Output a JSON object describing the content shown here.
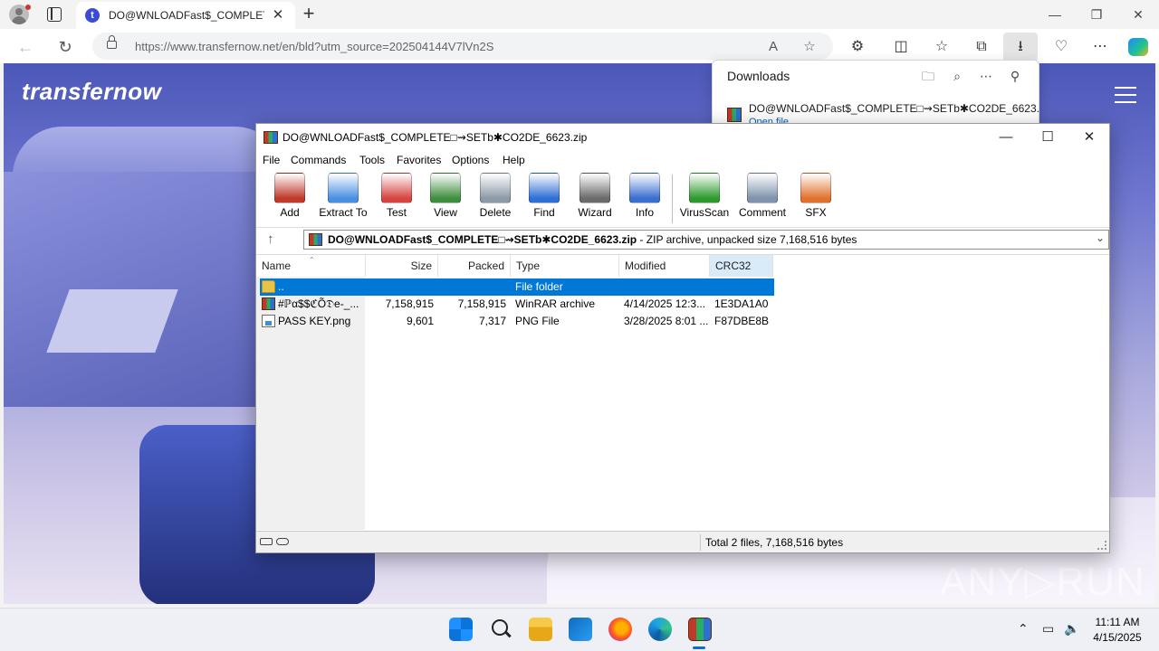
{
  "browser": {
    "tab_title": "DO@WNLOADFast$_COMPLETE□",
    "tab_favicon": "t",
    "url_host": "https://www.transfernow.net",
    "url_path": "/en/bld?utm_source=202504144V7lVn2S",
    "icons": [
      "back-icon",
      "refresh-icon",
      "lock-icon",
      "read-aloud-icon",
      "favorite-star-icon",
      "extensions-icon",
      "split-screen-icon",
      "favorites-icon",
      "collections-icon",
      "downloads-icon",
      "browser-essentials-icon",
      "more-icon",
      "copilot-icon"
    ]
  },
  "page": {
    "brand": "transfernow",
    "watermark": "ANY▷RUN"
  },
  "downloads": {
    "title": "Downloads",
    "item_name": "DO@WNLOADFast$_COMPLETE□⇝SETb✱CO2DE_6623....",
    "item_action": "Open file"
  },
  "winrar": {
    "title": "DO@WNLOADFast$_COMPLETE□⇝SETb✱CO2DE_6623.zip",
    "menu": [
      "File",
      "Commands",
      "Tools",
      "Favorites",
      "Options",
      "Help"
    ],
    "tools": [
      {
        "label": "Add",
        "color": "#c0392b"
      },
      {
        "label": "Extract To",
        "color": "#4a90e2"
      },
      {
        "label": "Test",
        "color": "#d64541"
      },
      {
        "label": "View",
        "color": "#3f8f3f"
      },
      {
        "label": "Delete",
        "color": "#8c9aa8"
      },
      {
        "label": "Find",
        "color": "#2f6fd6"
      },
      {
        "label": "Wizard",
        "color": "#6b6b6b"
      },
      {
        "label": "Info",
        "color": "#3b6fd0"
      },
      {
        "label": "VirusScan",
        "color": "#2e9b2e"
      },
      {
        "label": "Comment",
        "color": "#7f93ad"
      },
      {
        "label": "SFX",
        "color": "#e0722d"
      }
    ],
    "path_name": "DO@WNLOADFast$_COMPLETE□⇝SETb✱CO2DE_6623.zip",
    "path_desc": " - ZIP archive, unpacked size 7,168,516 bytes",
    "columns": [
      "Name",
      "Size",
      "Packed",
      "Type",
      "Modified",
      "CRC32"
    ],
    "rows": [
      {
        "name": "..",
        "size": "",
        "packed": "",
        "type": "File folder",
        "modified": "",
        "crc": ""
      },
      {
        "name": "#ℙα$$ℭÕ𝔇e-_...",
        "size": "7,158,915",
        "packed": "7,158,915",
        "type": "WinRAR archive",
        "modified": "4/14/2025 12:3...",
        "crc": "1E3DA1A0"
      },
      {
        "name": "PASS KEY.png",
        "size": "9,601",
        "packed": "7,317",
        "type": "PNG File",
        "modified": "3/28/2025 8:01 ...",
        "crc": "F87DBE8B"
      }
    ],
    "status": "Total 2 files, 7,168,516 bytes"
  },
  "taskbar": {
    "apps": [
      "start-icon",
      "search-icon",
      "file-explorer-icon",
      "store-icon",
      "firefox-icon",
      "edge-icon",
      "winrar-icon"
    ],
    "time": "11:11 AM",
    "date": "4/15/2025"
  }
}
